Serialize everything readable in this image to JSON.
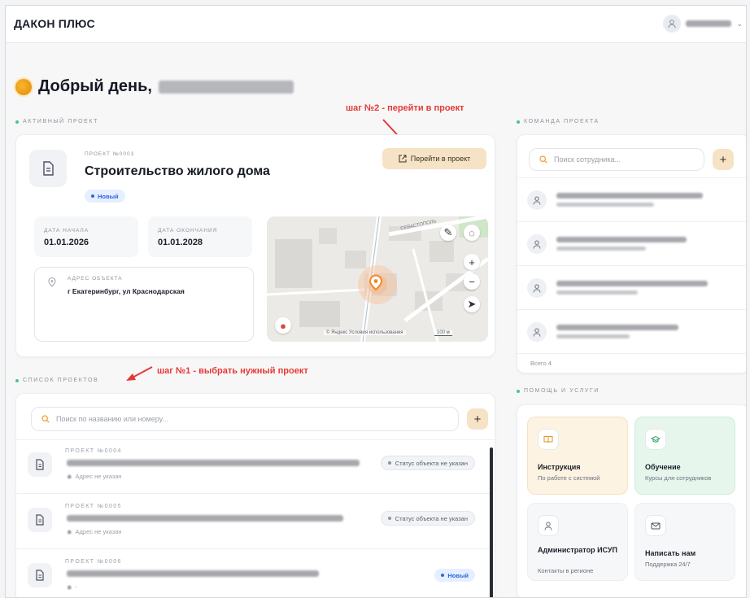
{
  "header": {
    "brand": "ДАКОН ПЛЮС"
  },
  "greeting": {
    "text": "Добрый день,"
  },
  "annotations": {
    "step2": "шаг №2 - перейти в проект",
    "step1": "шаг №1 - выбрать нужный проект"
  },
  "active_project": {
    "section_title": "АКТИВНЫЙ ПРОЕКТ",
    "number_label": "ПРОЕКТ №0003",
    "title": "Строительство жилого дома",
    "badge": "Новый",
    "go_button": "Перейти в проект",
    "start_label": "ДАТА НАЧАЛА",
    "start_value": "01.01.2026",
    "end_label": "ДАТА ОКОНЧАНИЯ",
    "end_value": "01.01.2028",
    "address_label": "АДРЕС ОБЪЕКТА",
    "address_value": "г Екатеринбург, ул Краснодарская",
    "map_footer": "© Яндекс   Условия использования",
    "map_scale": "100 м",
    "map_street": "СЕВАСТОПОЛЬ"
  },
  "team": {
    "section_title": "КОМАНДА ПРОЕКТА",
    "search_placeholder": "Поиск сотрудника...",
    "total": "Всего 4"
  },
  "projects_list": {
    "section_title": "СПИСОК ПРОЕКТОВ",
    "search_placeholder": "Поиск по названию или номеру...",
    "rows": [
      {
        "number": "ПРОЕКТ №0004",
        "address": "Адрес не указан",
        "status": "Статус объекта не указан"
      },
      {
        "number": "ПРОЕКТ №0005",
        "address": "Адрес не указан",
        "status": "Статус объекта не указан"
      },
      {
        "number": "ПРОЕКТ №0006",
        "address": "-",
        "status": "Новый"
      }
    ]
  },
  "help": {
    "section_title": "ПОМОЩЬ И УСЛУГИ",
    "tiles": [
      {
        "title": "Инструкция",
        "subtitle": "По работе с системой",
        "icon": "book-icon"
      },
      {
        "title": "Обучение",
        "subtitle": "Курсы для сотрудников",
        "icon": "graduation-cap-icon"
      },
      {
        "title": "Администратор ИСУП",
        "subtitle": "Контакты в регионе",
        "icon": "person-icon"
      },
      {
        "title": "Написать нам",
        "subtitle": "Поддержка 24/7",
        "icon": "mail-icon"
      }
    ]
  },
  "colors": {
    "accent_warm": "#f6e3c6",
    "annotation_red": "#e53935",
    "badge_blue": "#2f67e0",
    "section_dot": "#4cc38a"
  }
}
